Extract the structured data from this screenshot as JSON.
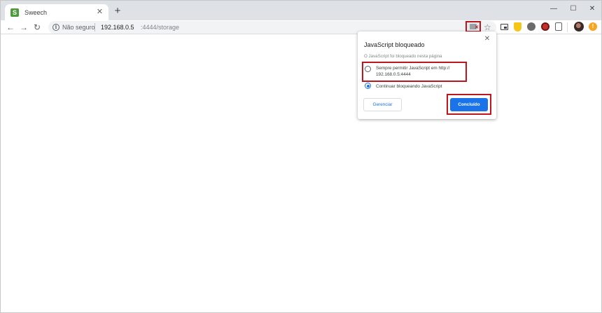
{
  "tab": {
    "title": "Sweech",
    "favicon_letter": "S"
  },
  "window_controls": {
    "minimize": "—",
    "maximize": "☐",
    "close": "✕"
  },
  "toolbar": {
    "back": "←",
    "forward": "→",
    "reload": "↻",
    "security_label": "Não seguro",
    "url_host": "192.168.0.5",
    "url_path": ":4444/storage"
  },
  "bubble": {
    "title": "JavaScript bloqueado",
    "description": "O JavaScript foi bloqueado nesta página",
    "options": [
      {
        "label_line1": "Sempre permitir JavaScript em http://",
        "label_line2": "192.168.0.5:4444",
        "selected": false
      },
      {
        "label_line1": "Continuar bloqueando JavaScript",
        "selected": true
      }
    ],
    "manage_label": "Gerenciar",
    "done_label": "Concluído"
  },
  "colors": {
    "accent": "#1a73e8",
    "highlight": "#c0141e"
  }
}
